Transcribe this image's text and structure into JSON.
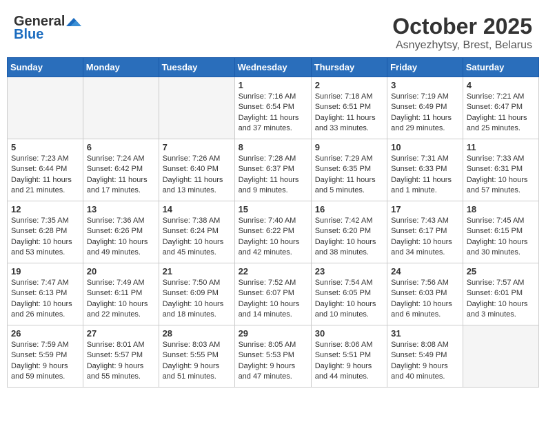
{
  "header": {
    "logo_general": "General",
    "logo_blue": "Blue",
    "month": "October 2025",
    "location": "Asnyezhytsy, Brest, Belarus"
  },
  "weekdays": [
    "Sunday",
    "Monday",
    "Tuesday",
    "Wednesday",
    "Thursday",
    "Friday",
    "Saturday"
  ],
  "weeks": [
    [
      {
        "day": "",
        "empty": true
      },
      {
        "day": "",
        "empty": true
      },
      {
        "day": "",
        "empty": true
      },
      {
        "day": "1",
        "sunrise": "7:16 AM",
        "sunset": "6:54 PM",
        "daylight": "11 hours and 37 minutes."
      },
      {
        "day": "2",
        "sunrise": "7:18 AM",
        "sunset": "6:51 PM",
        "daylight": "11 hours and 33 minutes."
      },
      {
        "day": "3",
        "sunrise": "7:19 AM",
        "sunset": "6:49 PM",
        "daylight": "11 hours and 29 minutes."
      },
      {
        "day": "4",
        "sunrise": "7:21 AM",
        "sunset": "6:47 PM",
        "daylight": "11 hours and 25 minutes."
      }
    ],
    [
      {
        "day": "5",
        "sunrise": "7:23 AM",
        "sunset": "6:44 PM",
        "daylight": "11 hours and 21 minutes."
      },
      {
        "day": "6",
        "sunrise": "7:24 AM",
        "sunset": "6:42 PM",
        "daylight": "11 hours and 17 minutes."
      },
      {
        "day": "7",
        "sunrise": "7:26 AM",
        "sunset": "6:40 PM",
        "daylight": "11 hours and 13 minutes."
      },
      {
        "day": "8",
        "sunrise": "7:28 AM",
        "sunset": "6:37 PM",
        "daylight": "11 hours and 9 minutes."
      },
      {
        "day": "9",
        "sunrise": "7:29 AM",
        "sunset": "6:35 PM",
        "daylight": "11 hours and 5 minutes."
      },
      {
        "day": "10",
        "sunrise": "7:31 AM",
        "sunset": "6:33 PM",
        "daylight": "11 hours and 1 minute."
      },
      {
        "day": "11",
        "sunrise": "7:33 AM",
        "sunset": "6:31 PM",
        "daylight": "10 hours and 57 minutes."
      }
    ],
    [
      {
        "day": "12",
        "sunrise": "7:35 AM",
        "sunset": "6:28 PM",
        "daylight": "10 hours and 53 minutes."
      },
      {
        "day": "13",
        "sunrise": "7:36 AM",
        "sunset": "6:26 PM",
        "daylight": "10 hours and 49 minutes."
      },
      {
        "day": "14",
        "sunrise": "7:38 AM",
        "sunset": "6:24 PM",
        "daylight": "10 hours and 45 minutes."
      },
      {
        "day": "15",
        "sunrise": "7:40 AM",
        "sunset": "6:22 PM",
        "daylight": "10 hours and 42 minutes."
      },
      {
        "day": "16",
        "sunrise": "7:42 AM",
        "sunset": "6:20 PM",
        "daylight": "10 hours and 38 minutes."
      },
      {
        "day": "17",
        "sunrise": "7:43 AM",
        "sunset": "6:17 PM",
        "daylight": "10 hours and 34 minutes."
      },
      {
        "day": "18",
        "sunrise": "7:45 AM",
        "sunset": "6:15 PM",
        "daylight": "10 hours and 30 minutes."
      }
    ],
    [
      {
        "day": "19",
        "sunrise": "7:47 AM",
        "sunset": "6:13 PM",
        "daylight": "10 hours and 26 minutes."
      },
      {
        "day": "20",
        "sunrise": "7:49 AM",
        "sunset": "6:11 PM",
        "daylight": "10 hours and 22 minutes."
      },
      {
        "day": "21",
        "sunrise": "7:50 AM",
        "sunset": "6:09 PM",
        "daylight": "10 hours and 18 minutes."
      },
      {
        "day": "22",
        "sunrise": "7:52 AM",
        "sunset": "6:07 PM",
        "daylight": "10 hours and 14 minutes."
      },
      {
        "day": "23",
        "sunrise": "7:54 AM",
        "sunset": "6:05 PM",
        "daylight": "10 hours and 10 minutes."
      },
      {
        "day": "24",
        "sunrise": "7:56 AM",
        "sunset": "6:03 PM",
        "daylight": "10 hours and 6 minutes."
      },
      {
        "day": "25",
        "sunrise": "7:57 AM",
        "sunset": "6:01 PM",
        "daylight": "10 hours and 3 minutes."
      }
    ],
    [
      {
        "day": "26",
        "sunrise": "7:59 AM",
        "sunset": "5:59 PM",
        "daylight": "9 hours and 59 minutes."
      },
      {
        "day": "27",
        "sunrise": "8:01 AM",
        "sunset": "5:57 PM",
        "daylight": "9 hours and 55 minutes."
      },
      {
        "day": "28",
        "sunrise": "8:03 AM",
        "sunset": "5:55 PM",
        "daylight": "9 hours and 51 minutes."
      },
      {
        "day": "29",
        "sunrise": "8:05 AM",
        "sunset": "5:53 PM",
        "daylight": "9 hours and 47 minutes."
      },
      {
        "day": "30",
        "sunrise": "8:06 AM",
        "sunset": "5:51 PM",
        "daylight": "9 hours and 44 minutes."
      },
      {
        "day": "31",
        "sunrise": "8:08 AM",
        "sunset": "5:49 PM",
        "daylight": "9 hours and 40 minutes."
      },
      {
        "day": "",
        "empty": true
      }
    ]
  ]
}
